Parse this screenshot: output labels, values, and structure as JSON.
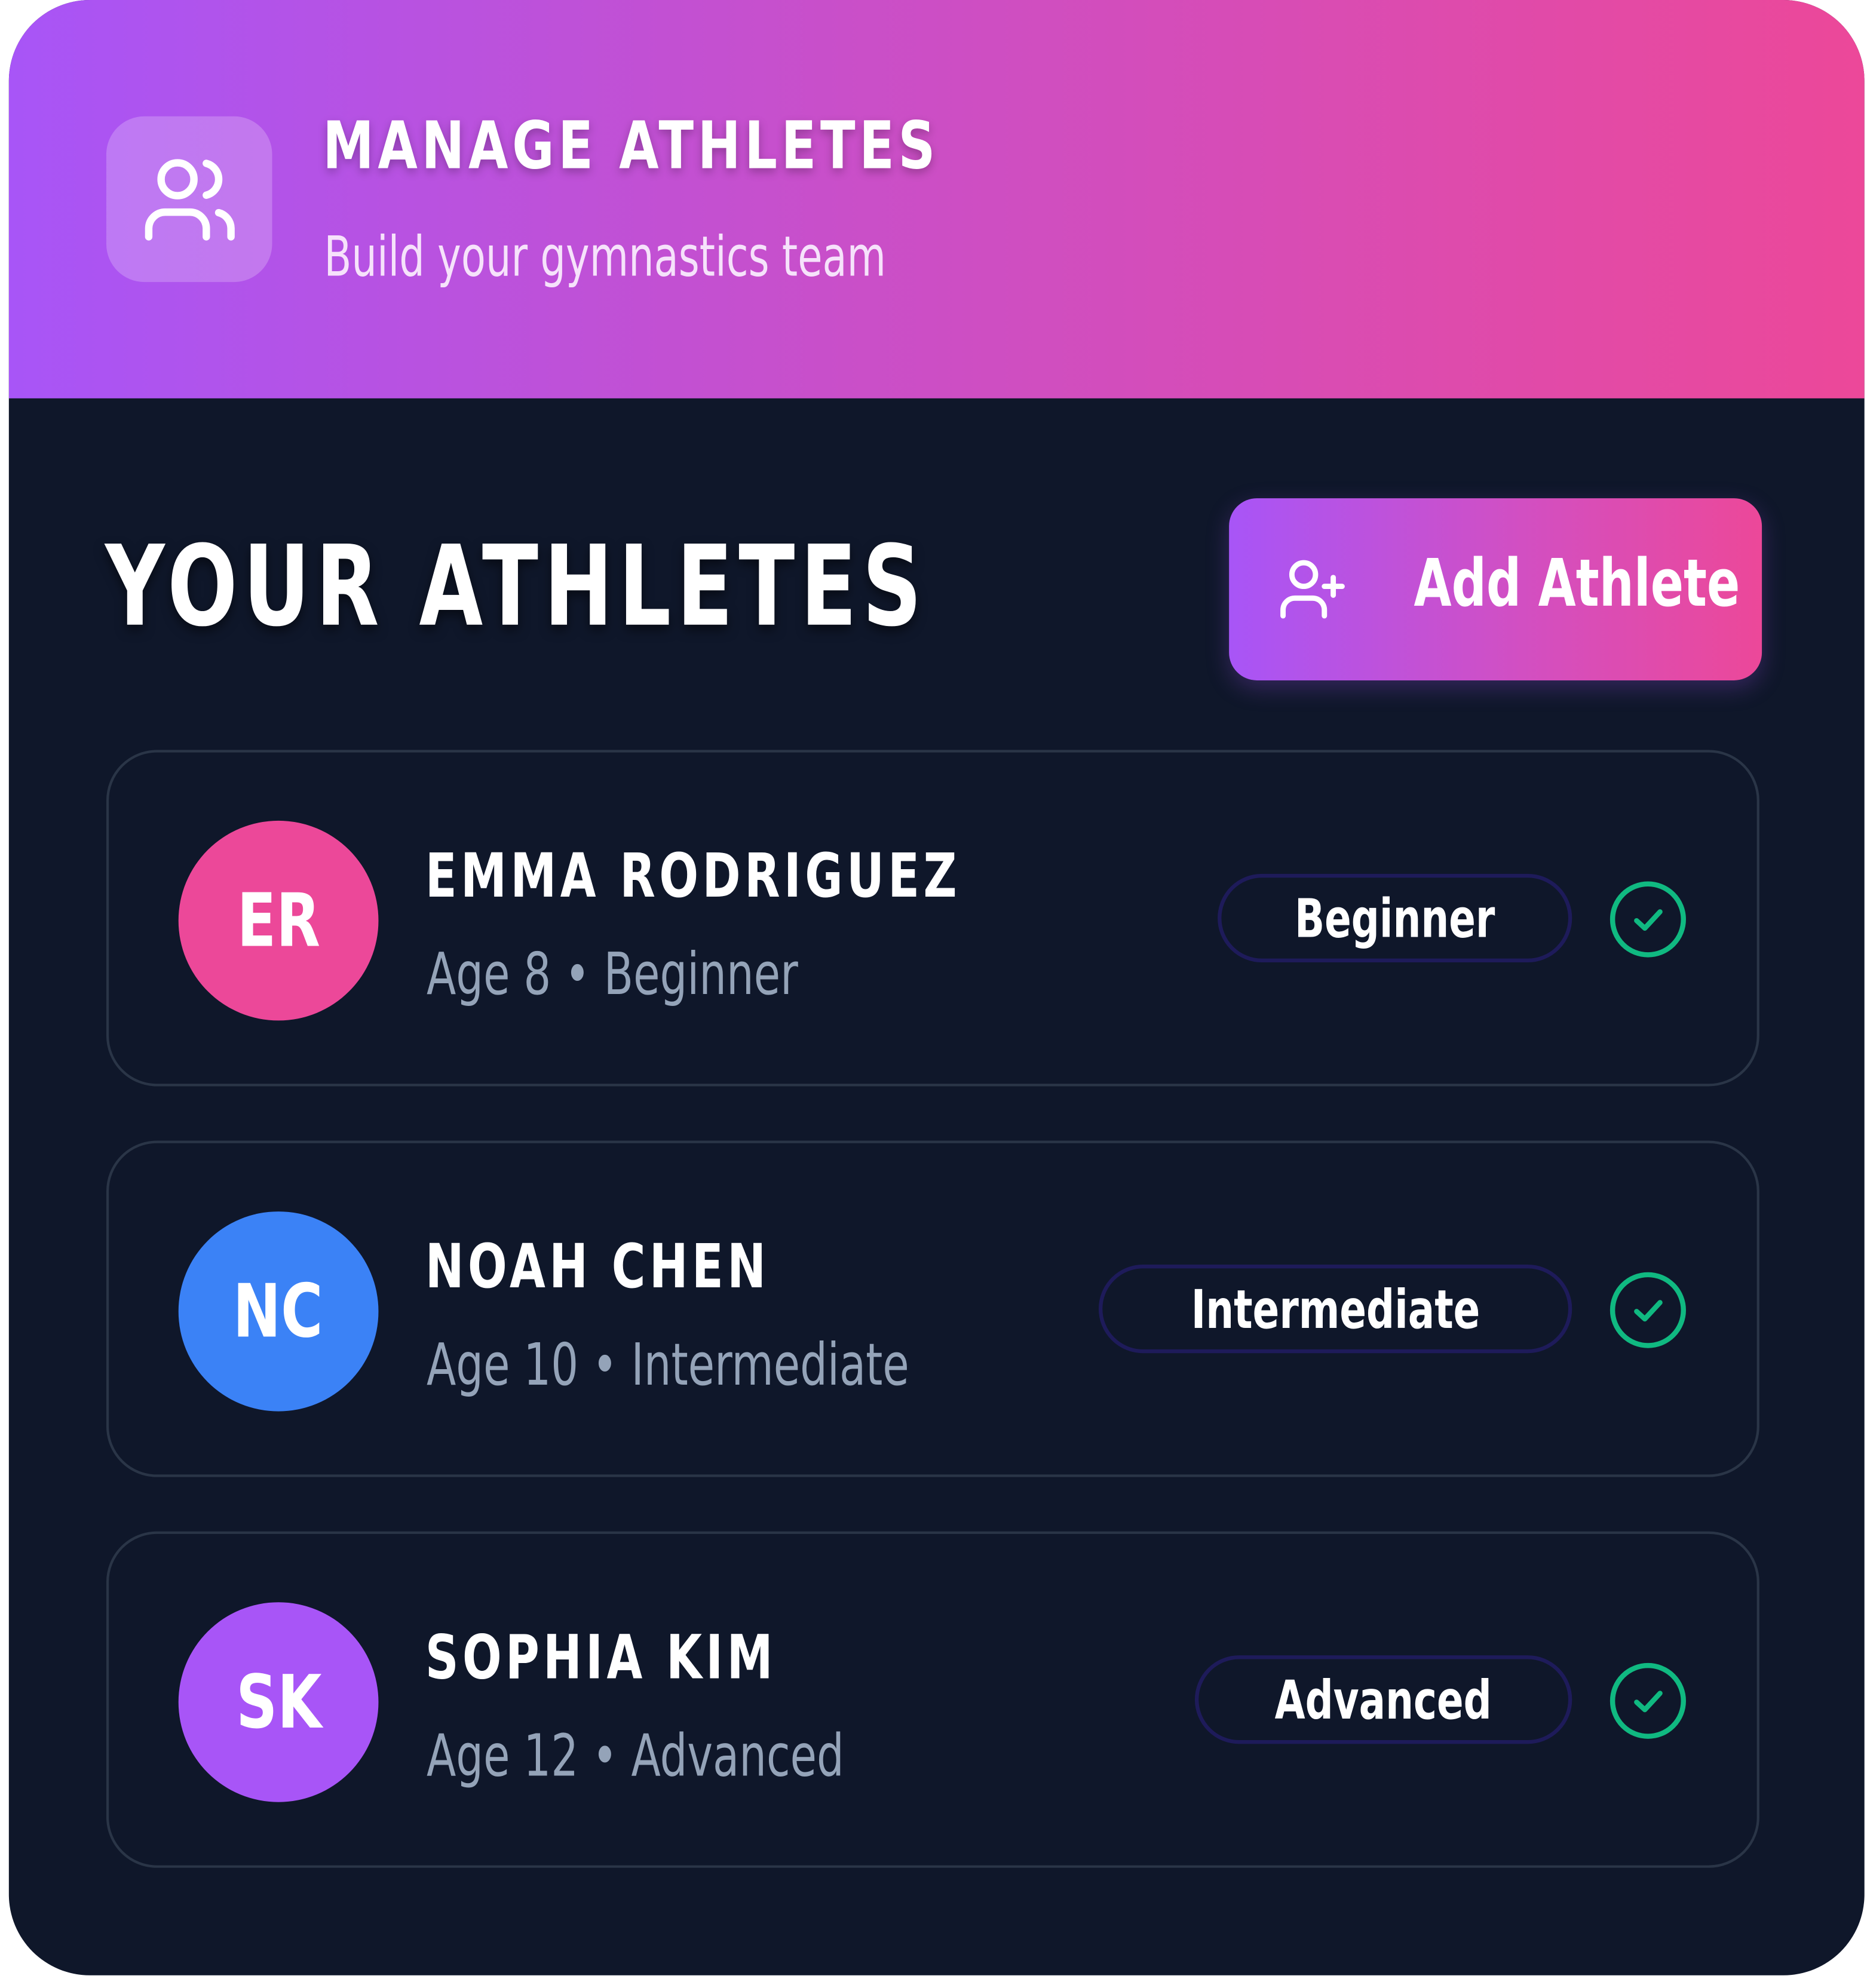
{
  "header": {
    "icon": "users-icon",
    "title": "MANAGE ATHLETES",
    "subtitle": "Build your gymnastics team"
  },
  "section": {
    "title": "YOUR ATHLETES"
  },
  "add_button": {
    "icon": "user-plus-icon",
    "label": "Add Athlete"
  },
  "athletes": [
    {
      "initials": "ER",
      "name": "EMMA RODRIGUEZ",
      "meta": "Age 8 • Beginner",
      "level": "Beginner",
      "avatar_color": "#ec4899",
      "status_icon": "check-circle-icon"
    },
    {
      "initials": "NC",
      "name": "NOAH CHEN",
      "meta": "Age 10 • Intermediate",
      "level": "Intermediate",
      "avatar_color": "#3b82f6",
      "status_icon": "check-circle-icon"
    },
    {
      "initials": "SK",
      "name": "SOPHIA KIM",
      "meta": "Age 12 • Advanced",
      "level": "Advanced",
      "avatar_color": "#a855f7",
      "status_icon": "check-circle-icon"
    }
  ],
  "colors": {
    "background": "#0f172a",
    "gradient_start": "#a855f7",
    "gradient_end": "#ec4899",
    "check_green": "#10b981",
    "muted_text": "#94a3b8"
  }
}
